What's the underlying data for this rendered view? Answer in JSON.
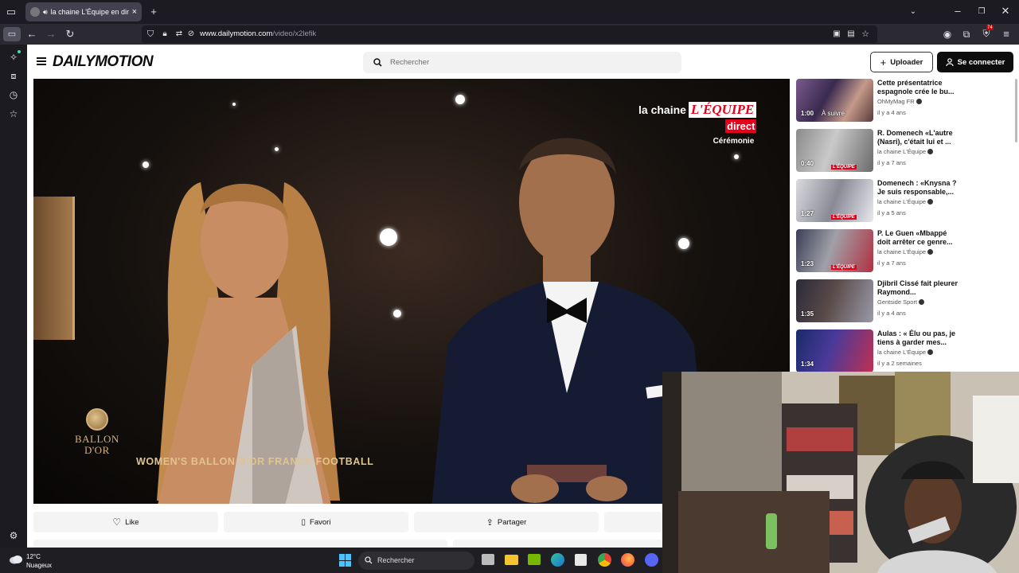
{
  "browser": {
    "tab_title": "la chaine L'Équipe en direct",
    "url_host": "www.dailymotion.com",
    "url_path": "/video/x2lefik",
    "badge": "74"
  },
  "site": {
    "logo": "DAILYMOTION",
    "search_placeholder": "Rechercher",
    "upload_label": "Uploader",
    "login_label": "Se connecter"
  },
  "player": {
    "channel_word": "la chaine",
    "channel_brand": "L'ÉQUIPE",
    "live_label": "direct",
    "program": "Cérémonie",
    "award_logo_line1": "BALLON",
    "award_logo_line2": "D'OR",
    "caption": "WOMEN'S BALLON D'OR FRANCE FOOTBALL"
  },
  "actions": {
    "like": "Like",
    "favori": "Favori",
    "partager": "Partager"
  },
  "suggestions": [
    {
      "duration": "1:00",
      "overlay": "À suivre",
      "title": "Cette présentatrice espagnole crée le bu...",
      "channel": "OhMyMag FR",
      "age": "il y a 4 ans"
    },
    {
      "duration": "0:40",
      "overlay": "L'ÉQUIPE",
      "title": "R. Domenech «L'autre (Nasri), c'était lui et ...",
      "channel": "la chaine L'Équipe",
      "age": "il y a 7 ans"
    },
    {
      "duration": "1:27",
      "overlay": "L'ÉQUIPE",
      "title": "Domenech : «Knysna ? Je suis responsable,...",
      "channel": "la chaine L'Équipe",
      "age": "il y a 5 ans"
    },
    {
      "duration": "1:23",
      "overlay": "L'ÉQUIPE",
      "title": "P. Le Guen «Mbappé doit arrêter ce genre...",
      "channel": "la chaine L'Équipe",
      "age": "il y a 7 ans"
    },
    {
      "duration": "1:35",
      "overlay": "",
      "title": "Djibril Cissé fait pleurer Raymond...",
      "channel": "Gentside Sport",
      "age": "il y a 4 ans"
    },
    {
      "duration": "1:34",
      "overlay": "",
      "title": "Aulas : « Élu ou pas, je tiens à garder mes...",
      "channel": "la chaine L'Équipe",
      "age": "il y a 2 semaines"
    }
  ],
  "taskbar": {
    "temperature": "12°C",
    "condition": "Nuageux",
    "search_placeholder": "Rechercher"
  },
  "colors": {
    "brand_red": "#e2001a",
    "chrome_dark": "#1c1b22",
    "chrome_mid": "#2b2a33"
  }
}
